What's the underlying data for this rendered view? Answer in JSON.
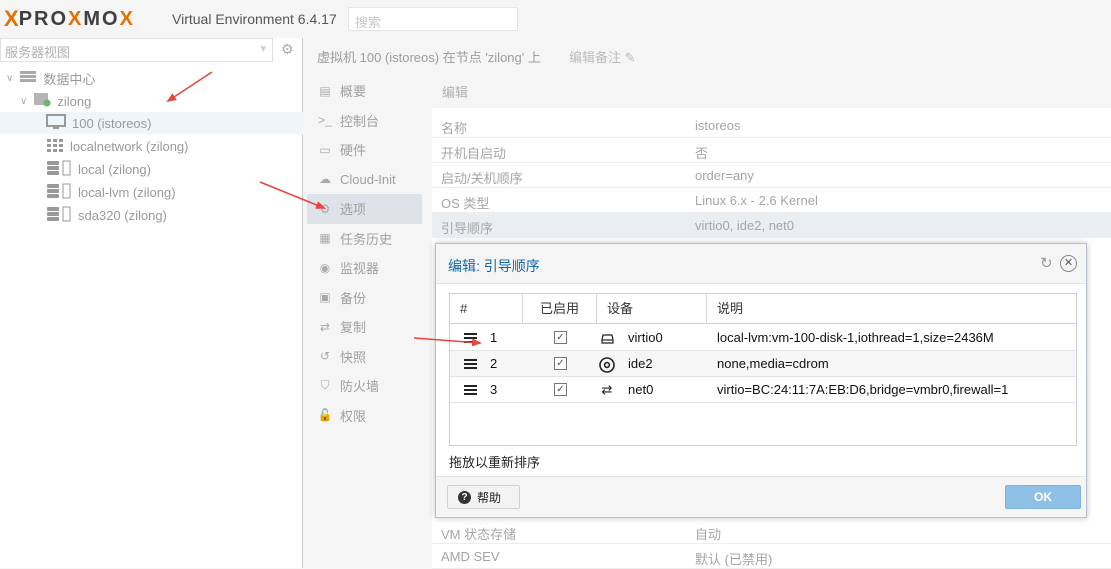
{
  "header": {
    "logo_x": "X",
    "logo_word_a": "PRO",
    "logo_word_x": "X",
    "logo_word_b": "MO",
    "logo_word_x2": "X",
    "version": "Virtual Environment 6.4.17",
    "search_placeholder": "搜索"
  },
  "tree": {
    "view_select": "服务器视图",
    "items": [
      {
        "label": "数据中心",
        "icon": "datacenter-icon"
      },
      {
        "label": "zilong",
        "icon": "node-icon"
      },
      {
        "label": "100 (istoreos)",
        "icon": "vm-icon"
      },
      {
        "label": "localnetwork (zilong)",
        "icon": "network-grid-icon"
      },
      {
        "label": "local (zilong)",
        "icon": "storage-icon"
      },
      {
        "label": "local-lvm (zilong)",
        "icon": "storage-icon"
      },
      {
        "label": "sda320 (zilong)",
        "icon": "storage-icon"
      }
    ]
  },
  "breadcrumb": {
    "title": "虚拟机 100 (istoreos) 在节点 'zilong' 上",
    "notes": "编辑备注"
  },
  "nav": [
    {
      "label": "概要",
      "glyph": "▤"
    },
    {
      "label": "控制台",
      "glyph": ">_"
    },
    {
      "label": "硬件",
      "glyph": "▭"
    },
    {
      "label": "Cloud-Init",
      "glyph": "☁"
    },
    {
      "label": "选项",
      "glyph": "⚙"
    },
    {
      "label": "任务历史",
      "glyph": "▦"
    },
    {
      "label": "监视器",
      "glyph": "◉"
    },
    {
      "label": "备份",
      "glyph": "▣"
    },
    {
      "label": "复制",
      "glyph": "⇄"
    },
    {
      "label": "快照",
      "glyph": "↺"
    },
    {
      "label": "防火墙",
      "glyph": "⛉"
    },
    {
      "label": "权限",
      "glyph": "🔓"
    }
  ],
  "options": {
    "edit_label": "编辑",
    "rows": [
      {
        "key": "名称",
        "value": "istoreos"
      },
      {
        "key": "开机自启动",
        "value": "否"
      },
      {
        "key": "启动/关机顺序",
        "value": "order=any"
      },
      {
        "key": "OS 类型",
        "value": "Linux 6.x - 2.6 Kernel"
      },
      {
        "key": "引导顺序",
        "value": "virtio0, ide2, net0"
      }
    ],
    "bottom_rows": [
      {
        "key": "VM 状态存储",
        "value": "自动"
      },
      {
        "key": "AMD SEV",
        "value": "默认 (已禁用)"
      }
    ]
  },
  "dialog": {
    "title": "编辑: 引导顺序",
    "columns": [
      "#",
      "已启用",
      "设备",
      "说明"
    ],
    "rows": [
      {
        "num": "1",
        "enabled": "✓",
        "device": "virtio0",
        "device_icon": "disk-icon",
        "desc": "local-lvm:vm-100-disk-1,iothread=1,size=2436M"
      },
      {
        "num": "2",
        "enabled": "✓",
        "device": "ide2",
        "device_icon": "cdrom-icon",
        "desc": "none,media=cdrom"
      },
      {
        "num": "3",
        "enabled": "✓",
        "device": "net0",
        "device_icon": "network-exchange-icon",
        "desc": "virtio=BC:24:11:7A:EB:D6,bridge=vmbr0,firewall=1"
      }
    ],
    "hint": "拖放以重新排序",
    "help_label": "帮助",
    "ok_label": "OK"
  },
  "colors": {
    "accent": "#e57000",
    "dialog_title": "#0d6aa8",
    "ok_button": "#8fc0e6",
    "arrow": "#e8463c"
  }
}
